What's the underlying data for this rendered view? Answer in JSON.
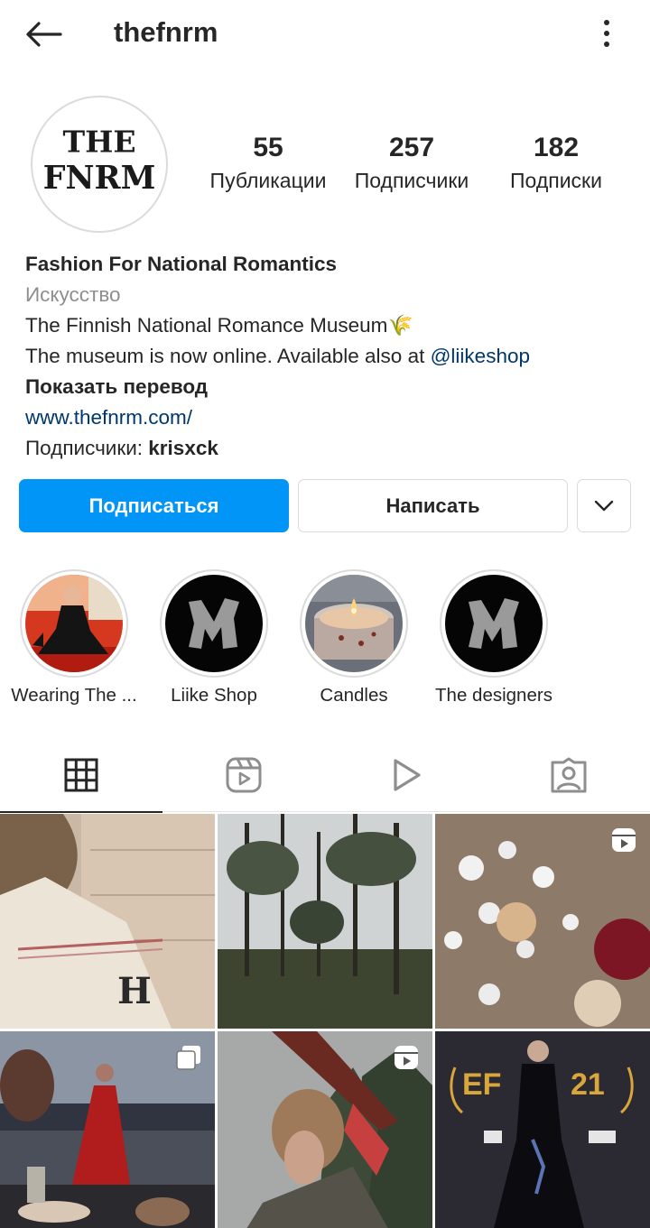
{
  "header": {
    "username": "thefnrm",
    "back_icon": "arrow-left-icon",
    "more_icon": "more-vertical-icon"
  },
  "profile": {
    "avatar_text_line1": "THE",
    "avatar_text_line2": "FNRM",
    "stats": [
      {
        "value": "55",
        "label": "Публикации"
      },
      {
        "value": "257",
        "label": "Подписчики"
      },
      {
        "value": "182",
        "label": "Подписки"
      }
    ]
  },
  "bio": {
    "name": "Fashion For National Romantics",
    "category": "Искусство",
    "line1": "The Finnish National Romance Museum",
    "line1_emoji": "🌾",
    "line2_prefix": "The museum is now online. Available also at ",
    "line2_mention": "@liikeshop",
    "translate": "Показать перевод",
    "website": "www.thefnrm.com/",
    "followed_prefix": "Подписчики: ",
    "followed_user": "krisxck"
  },
  "actions": {
    "follow_label": "Подписаться",
    "message_label": "Написать",
    "more_icon": "chevron-down-icon"
  },
  "highlights": [
    {
      "label": "Wearing The ..."
    },
    {
      "label": "Liike Shop"
    },
    {
      "label": "Candles"
    },
    {
      "label": "The designers"
    }
  ],
  "tabs": [
    {
      "icon": "grid-icon",
      "active": true
    },
    {
      "icon": "reels-icon",
      "active": false
    },
    {
      "icon": "play-icon",
      "active": false
    },
    {
      "icon": "tagged-icon",
      "active": false
    }
  ],
  "colors": {
    "primary": "#0095f6",
    "text": "#262626",
    "secondary_text": "#8e8e8e",
    "link": "#00376b",
    "border": "#dbdbdb"
  }
}
